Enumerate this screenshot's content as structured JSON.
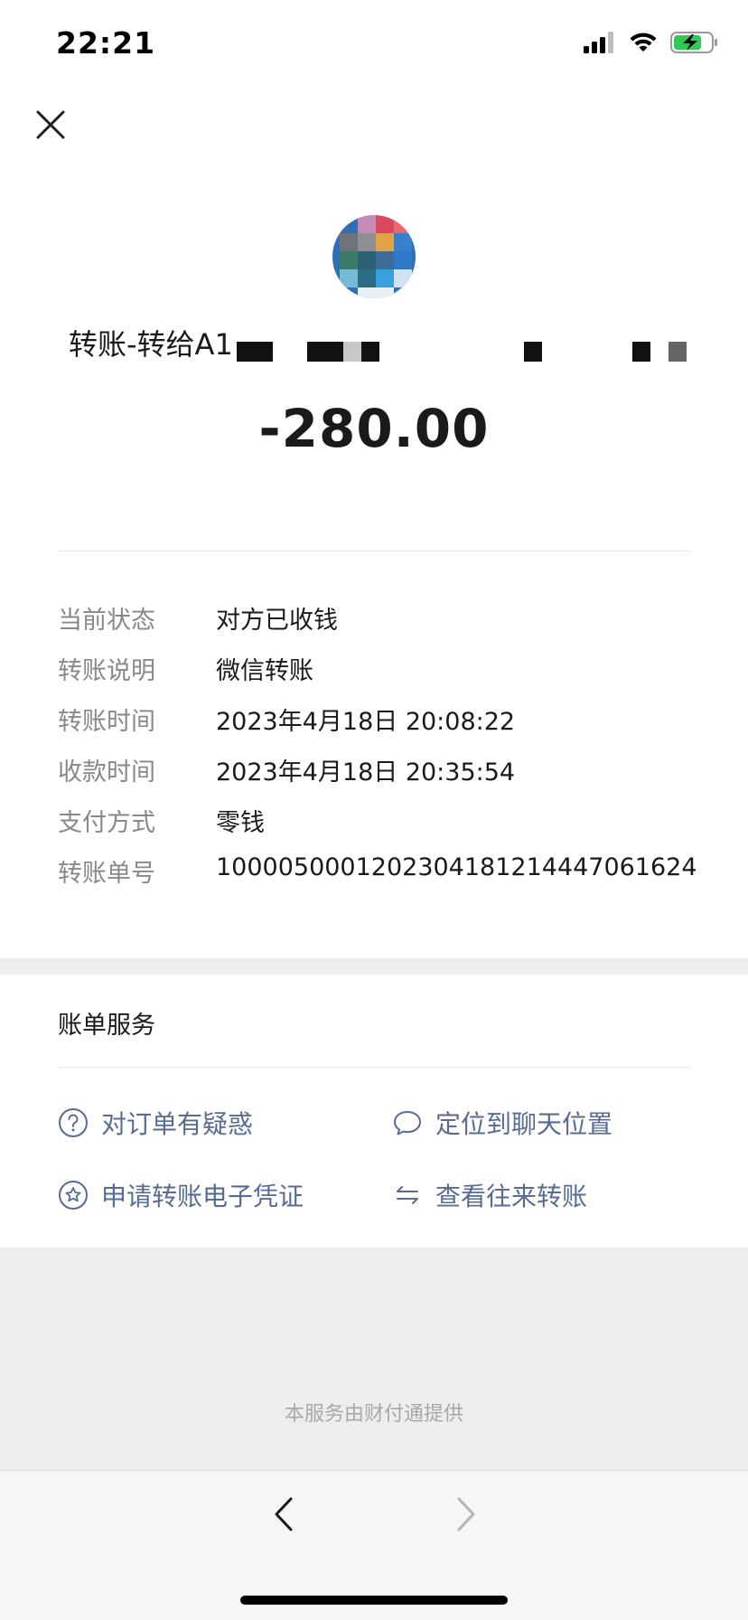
{
  "status_bar": {
    "time": "22:21"
  },
  "header": {
    "close_icon": "close-icon"
  },
  "transfer": {
    "title": "转账-转给A1",
    "amount": "-280.00"
  },
  "details": [
    {
      "label": "当前状态",
      "value": "对方已收钱"
    },
    {
      "label": "转账说明",
      "value": "微信转账"
    },
    {
      "label": "转账时间",
      "value": "2023年4月18日 20:08:22"
    },
    {
      "label": "收款时间",
      "value": "2023年4月18日 20:35:54"
    },
    {
      "label": "支付方式",
      "value": "零钱"
    },
    {
      "label": "转账单号",
      "value": "1000050001202304181214447061624"
    }
  ],
  "bill_services": {
    "title": "账单服务",
    "items": [
      {
        "label": "对订单有疑惑",
        "icon": "question-circle-icon"
      },
      {
        "label": "定位到聊天位置",
        "icon": "chat-bubble-icon"
      },
      {
        "label": "申请转账电子凭证",
        "icon": "star-circle-icon"
      },
      {
        "label": "查看往来转账",
        "icon": "swap-arrows-icon"
      }
    ]
  },
  "footer": {
    "text": "本服务由财付通提供"
  },
  "colors": {
    "link": "#576b95",
    "label": "#888888",
    "background_band": "#ededed",
    "battery": "#34c759"
  }
}
